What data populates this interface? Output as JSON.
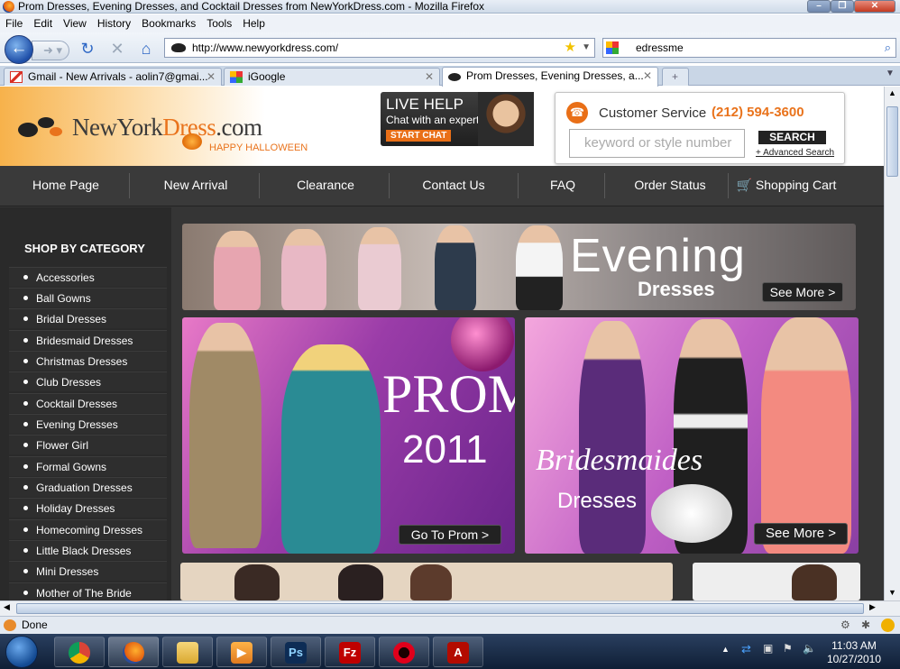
{
  "window": {
    "title": "Prom Dresses, Evening Dresses, and Cocktail Dresses from NewYorkDress.com - Mozilla Firefox"
  },
  "menu": [
    "File",
    "Edit",
    "View",
    "History",
    "Bookmarks",
    "Tools",
    "Help"
  ],
  "toolbar": {
    "url": "http://www.newyorkdress.com/",
    "search_value": "edressme"
  },
  "tabs": [
    {
      "label": "Gmail - New Arrivals - aolin7@gmai...",
      "icon": "gmail-icon"
    },
    {
      "label": "iGoogle",
      "icon": "igoogle-icon"
    },
    {
      "label": "Prom Dresses, Evening Dresses, a...",
      "icon": "newyorkdress-favicon",
      "active": true
    }
  ],
  "header": {
    "logo_prefix": "NewYork",
    "logo_accent": "Dress",
    "logo_suffix": ".com",
    "logo_tagline": "HAPPY HALLOWEEN",
    "live_help_title": "LIVE HELP",
    "live_help_sub": "Chat with an expert",
    "live_help_button": "START CHAT",
    "cs_label": "Customer Service",
    "cs_phone": "(212) 594-3600",
    "search_placeholder": "keyword or style number",
    "search_button": "SEARCH",
    "advanced_search": "Advanced Search"
  },
  "nav": [
    "Home Page",
    "New Arrival",
    "Clearance",
    "Contact Us",
    "FAQ",
    "Order Status",
    "Shopping Cart"
  ],
  "sidebar": {
    "heading": "SHOP BY CATEGORY",
    "items": [
      "Accessories",
      "Ball Gowns",
      "Bridal Dresses",
      "Bridesmaid Dresses",
      "Christmas Dresses",
      "Club Dresses",
      "Cocktail Dresses",
      "Evening Dresses",
      "Flower Girl",
      "Formal Gowns",
      "Graduation Dresses",
      "Holiday Dresses",
      "Homecoming Dresses",
      "Little Black Dresses",
      "Mini Dresses",
      "Mother of The Bride"
    ]
  },
  "banners": {
    "evening_title": "Evening",
    "evening_sub": "Dresses",
    "evening_button": "See More >",
    "prom_title": "PROM",
    "prom_year": "2011",
    "prom_button": "Go To Prom >",
    "bride_script": "Bridesmaides",
    "bride_sub": "Dresses",
    "bride_button": "See More >"
  },
  "status": {
    "text": "Done"
  },
  "clock": {
    "time": "11:03 AM",
    "date": "10/27/2010"
  },
  "colors": {
    "accent": "#e9731c",
    "nav_bg": "#3a3a3a",
    "page_bg": "#353535"
  }
}
